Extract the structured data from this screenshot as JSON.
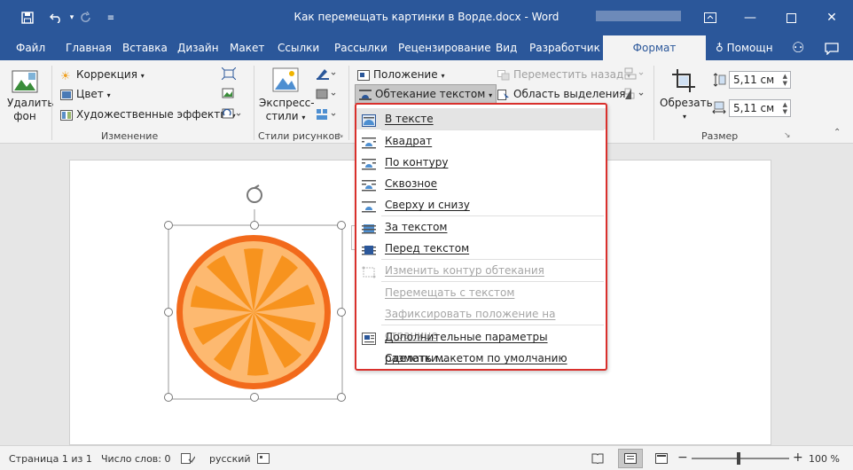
{
  "window": {
    "title": "Как перемещать картинки в Ворде.docx - Word"
  },
  "tabs": [
    "Файл",
    "Главная",
    "Вставка",
    "Дизайн",
    "Макет",
    "Ссылки",
    "Рассылки",
    "Рецензирование",
    "Вид",
    "Разработчик",
    "Формат"
  ],
  "tab_right": {
    "help": "Помощн"
  },
  "ribbon": {
    "remove_bg_line1": "Удалить",
    "remove_bg_line2": "фон",
    "correction": "Коррекция",
    "color": "Цвет",
    "artistic": "Художественные эффекты",
    "group_adjust": "Изменение",
    "express_line1": "Экспресс-",
    "express_line2": "стили",
    "group_styles": "Стили рисунков",
    "position": "Положение",
    "wrap_text": "Обтекание текстом",
    "send_back": "Переместить назад",
    "selection_pane": "Область выделения",
    "crop": "Обрезать",
    "height": "5,11 см",
    "width": "5,11 см",
    "group_size": "Размер"
  },
  "menu": {
    "items": [
      {
        "label": "В тексте"
      },
      {
        "label": "Квадрат"
      },
      {
        "label": "По контуру"
      },
      {
        "label": "Сквозное"
      },
      {
        "label": "Сверху и снизу"
      },
      {
        "label": "За текстом"
      },
      {
        "label": "Перед текстом"
      },
      {
        "label": "Изменить контур обтекания"
      },
      {
        "label": "Перемещать с текстом"
      },
      {
        "label": "Зафиксировать положение на странице"
      },
      {
        "label": "Дополнительные параметры разметки..."
      },
      {
        "label": "Сделать макетом по умолчанию"
      }
    ]
  },
  "status": {
    "page": "Страница 1 из 1",
    "words": "Число слов: 0",
    "language": "русский",
    "zoom": "100 %"
  },
  "colors": {
    "accent": "#2b579a",
    "menu_border": "#d9302c",
    "orange": "#f7931e",
    "orange_dark": "#f26a1b"
  }
}
